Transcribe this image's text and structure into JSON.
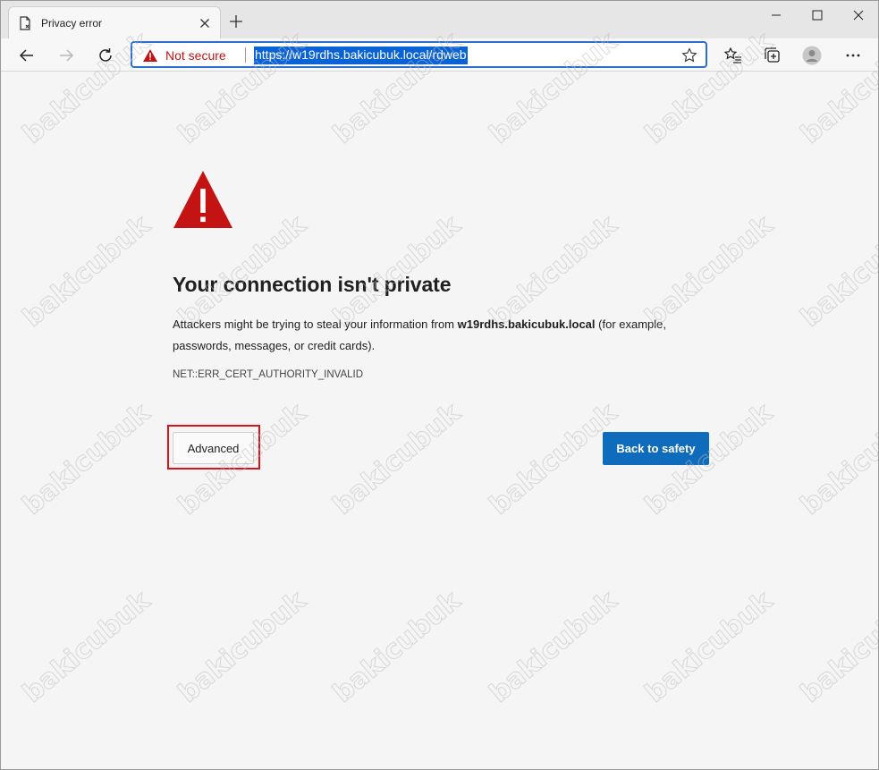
{
  "tab": {
    "title": "Privacy error"
  },
  "omnibox": {
    "security_label": "Not secure",
    "url": "https://w19rdhs.bakicubuk.local/rdweb"
  },
  "page": {
    "heading": "Your connection isn't private",
    "description_prefix": "Attackers might be trying to steal your information from ",
    "host": "w19rdhs.bakicubuk.local",
    "description_suffix": " (for example, passwords, messages, or credit cards).",
    "error_code": "NET::ERR_CERT_AUTHORITY_INVALID",
    "advanced_label": "Advanced",
    "back_label": "Back to safety"
  },
  "watermark": {
    "text": "bakicubuk"
  },
  "colors": {
    "warning_red": "#c41313",
    "accent_blue": "#0f6cbd",
    "highlight_box": "#d9131a"
  },
  "icons": {
    "tab_favicon": "page-error-icon",
    "back": "back-arrow-icon",
    "forward": "forward-arrow-icon",
    "reload": "reload-icon",
    "favorite": "star-icon",
    "favorites_list": "favorites-icon",
    "collections": "collections-icon",
    "profile": "profile-icon",
    "menu": "more-icon"
  }
}
